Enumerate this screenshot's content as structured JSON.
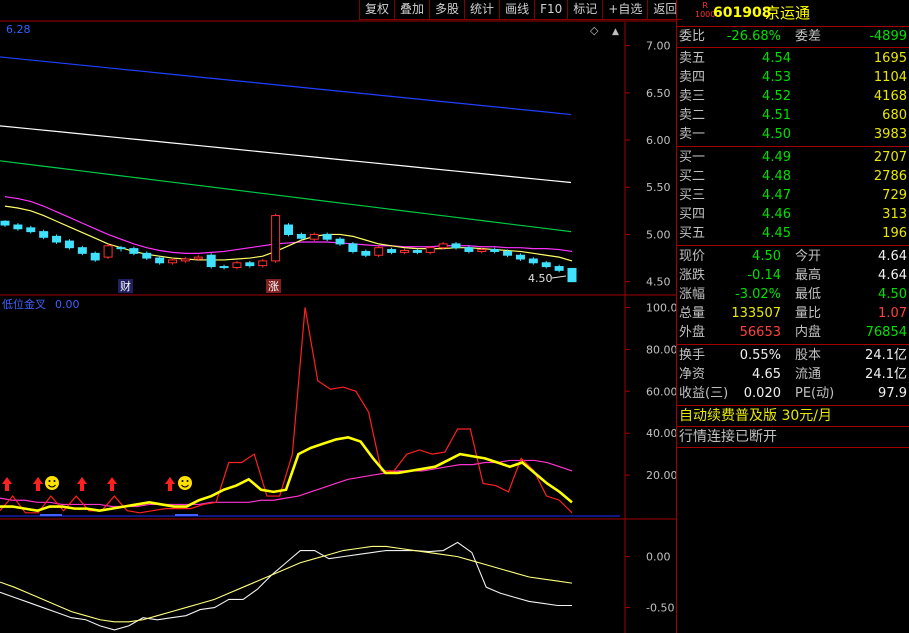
{
  "toolbar": [
    "复权",
    "叠加",
    "多股",
    "统计",
    "画线",
    "F10",
    "标记",
    "+自选",
    "返回"
  ],
  "main_panel": {
    "corner_value": "6.28",
    "price_ticks": [
      "7.00",
      "6.50",
      "6.00",
      "5.50",
      "5.00",
      "4.50"
    ],
    "last_price_label": "4.50",
    "markers": [
      {
        "text": "财",
        "color": "#ffffff",
        "bg": "#202060"
      },
      {
        "text": "涨",
        "color": "#ffffff",
        "bg": "#802020"
      }
    ]
  },
  "indicator_panel": {
    "title": "低位金叉",
    "value": "0.00",
    "ticks": [
      "100.0",
      "80.00",
      "60.00",
      "40.00",
      "20.00"
    ]
  },
  "osc_panel": {
    "ticks": [
      "0.00",
      "-0.50"
    ]
  },
  "quote": {
    "code": "601908",
    "name": "京运通",
    "r_badge": "R",
    "r_sub": "1000",
    "weibi_label": "委比",
    "weibi": "-26.68%",
    "weicha_label": "委差",
    "weicha": "-4899",
    "sell": [
      {
        "label": "卖五",
        "price": "4.54",
        "vol": "1695"
      },
      {
        "label": "卖四",
        "price": "4.53",
        "vol": "1104"
      },
      {
        "label": "卖三",
        "price": "4.52",
        "vol": "4168"
      },
      {
        "label": "卖二",
        "price": "4.51",
        "vol": "680"
      },
      {
        "label": "卖一",
        "price": "4.50",
        "vol": "3983"
      }
    ],
    "buy": [
      {
        "label": "买一",
        "price": "4.49",
        "vol": "2707"
      },
      {
        "label": "买二",
        "price": "4.48",
        "vol": "2786"
      },
      {
        "label": "买三",
        "price": "4.47",
        "vol": "729"
      },
      {
        "label": "买四",
        "price": "4.46",
        "vol": "313"
      },
      {
        "label": "买五",
        "price": "4.45",
        "vol": "196"
      }
    ],
    "stats": [
      {
        "l1": "现价",
        "v1": "4.50",
        "c1": "green",
        "l2": "今开",
        "v2": "4.64",
        "c2": "white"
      },
      {
        "l1": "涨跌",
        "v1": "-0.14",
        "c1": "green",
        "l2": "最高",
        "v2": "4.64",
        "c2": "white"
      },
      {
        "l1": "涨幅",
        "v1": "-3.02%",
        "c1": "green",
        "l2": "最低",
        "v2": "4.50",
        "c2": "green"
      },
      {
        "l1": "总量",
        "v1": "133507",
        "c1": "yellow",
        "l2": "量比",
        "v2": "1.07",
        "c2": "red"
      },
      {
        "l1": "外盘",
        "v1": "56653",
        "c1": "red",
        "l2": "内盘",
        "v2": "76854",
        "c2": "green"
      }
    ],
    "stats2": [
      {
        "l1": "换手",
        "v1": "0.55%",
        "c1": "white",
        "l2": "股本",
        "v2": "24.1亿",
        "c2": "white"
      },
      {
        "l1": "净资",
        "v1": "4.65",
        "c1": "white",
        "l2": "流通",
        "v2": "24.1亿",
        "c2": "white"
      },
      {
        "l1": "收益(三)",
        "v1": "0.020",
        "c1": "white",
        "l2": "PE(动)",
        "v2": "97.9",
        "c2": "white"
      }
    ],
    "promo": "自动续费普及版",
    "promo_price": "30元/月",
    "status": "行情连接已断开"
  },
  "chart_data": {
    "type": "candlestick",
    "panels": [
      {
        "name": "price",
        "ylim": [
          4.38,
          7.25
        ],
        "ticks": [
          7.0,
          6.5,
          6.0,
          5.5,
          5.0,
          4.5
        ],
        "last": 4.5
      },
      {
        "name": "indicator",
        "ylim": [
          0,
          105
        ],
        "ticks": [
          100,
          80,
          60,
          40,
          20
        ]
      },
      {
        "name": "oscillator",
        "ylim": [
          -0.75,
          0.35
        ],
        "ticks": [
          0.0,
          -0.5
        ]
      }
    ],
    "candles": [
      [
        5.14,
        5.1,
        5.15,
        5.08
      ],
      [
        5.1,
        5.06,
        5.12,
        5.04
      ],
      [
        5.07,
        5.03,
        5.09,
        5.01
      ],
      [
        5.03,
        4.97,
        5.05,
        4.95
      ],
      [
        4.98,
        4.92,
        5.0,
        4.9
      ],
      [
        4.93,
        4.86,
        4.95,
        4.84
      ],
      [
        4.86,
        4.8,
        4.88,
        4.78
      ],
      [
        4.8,
        4.73,
        4.82,
        4.71
      ],
      [
        4.76,
        4.88,
        4.9,
        4.74
      ],
      [
        4.86,
        4.85,
        4.88,
        4.82
      ],
      [
        4.85,
        4.8,
        4.87,
        4.78
      ],
      [
        4.8,
        4.75,
        4.82,
        4.73
      ],
      [
        4.75,
        4.7,
        4.77,
        4.68
      ],
      [
        4.7,
        4.73,
        4.75,
        4.68
      ],
      [
        4.72,
        4.74,
        4.76,
        4.7
      ],
      [
        4.74,
        4.76,
        4.78,
        4.72
      ],
      [
        4.78,
        4.66,
        4.8,
        4.64
      ],
      [
        4.66,
        4.65,
        4.68,
        4.63
      ],
      [
        4.65,
        4.7,
        4.72,
        4.63
      ],
      [
        4.7,
        4.67,
        4.72,
        4.65
      ],
      [
        4.67,
        4.72,
        4.74,
        4.65
      ],
      [
        4.72,
        5.2,
        5.22,
        4.7
      ],
      [
        5.1,
        5.0,
        5.12,
        4.98
      ],
      [
        5.0,
        4.96,
        5.02,
        4.94
      ],
      [
        4.95,
        5.0,
        5.02,
        4.93
      ],
      [
        5.0,
        4.95,
        5.02,
        4.93
      ],
      [
        4.95,
        4.9,
        4.97,
        4.88
      ],
      [
        4.9,
        4.82,
        4.92,
        4.8
      ],
      [
        4.82,
        4.78,
        4.84,
        4.76
      ],
      [
        4.78,
        4.86,
        4.88,
        4.76
      ],
      [
        4.84,
        4.81,
        4.86,
        4.79
      ],
      [
        4.81,
        4.83,
        4.85,
        4.79
      ],
      [
        4.83,
        4.81,
        4.85,
        4.79
      ],
      [
        4.81,
        4.86,
        4.88,
        4.79
      ],
      [
        4.86,
        4.9,
        4.92,
        4.84
      ],
      [
        4.9,
        4.86,
        4.92,
        4.84
      ],
      [
        4.86,
        4.82,
        4.88,
        4.8
      ],
      [
        4.82,
        4.84,
        4.86,
        4.8
      ],
      [
        4.84,
        4.82,
        4.86,
        4.8
      ],
      [
        4.82,
        4.78,
        4.84,
        4.76
      ],
      [
        4.78,
        4.74,
        4.8,
        4.72
      ],
      [
        4.74,
        4.7,
        4.76,
        4.68
      ],
      [
        4.7,
        4.66,
        4.72,
        4.64
      ],
      [
        4.66,
        4.62,
        4.68,
        4.6
      ],
      [
        4.64,
        4.5,
        4.64,
        4.5
      ]
    ],
    "ma": [
      {
        "color": "#2040ff",
        "from": 6.88,
        "to": 6.27
      },
      {
        "color": "#ffffff",
        "from": 6.15,
        "to": 5.55
      },
      {
        "color": "#00cc44",
        "from": 5.78,
        "to": 5.03
      },
      {
        "color": "#ff33ff",
        "p": [
          5.4,
          5.38,
          5.35,
          5.3,
          5.24,
          5.18,
          5.12,
          5.06,
          5.0,
          4.95,
          4.9,
          4.86,
          4.83,
          4.81,
          4.8,
          4.8,
          4.81,
          4.82,
          4.84,
          4.86,
          4.88,
          4.9,
          4.91,
          4.92,
          4.92,
          4.92,
          4.91,
          4.9,
          4.89,
          4.88,
          4.88,
          4.87,
          4.87,
          4.87,
          4.88,
          4.88,
          4.88,
          4.87,
          4.87,
          4.86,
          4.86,
          4.85,
          4.85,
          4.84,
          4.82
        ]
      },
      {
        "color": "#ffff66",
        "p": [
          5.3,
          5.28,
          5.25,
          5.2,
          5.14,
          5.08,
          5.02,
          4.96,
          4.9,
          4.86,
          4.82,
          4.79,
          4.77,
          4.75,
          4.74,
          4.73,
          4.73,
          4.73,
          4.74,
          4.75,
          4.77,
          4.82,
          4.88,
          4.94,
          4.98,
          5.0,
          5.0,
          4.98,
          4.94,
          4.9,
          4.88,
          4.86,
          4.85,
          4.85,
          4.85,
          4.86,
          4.86,
          4.85,
          4.84,
          4.83,
          4.82,
          4.8,
          4.78,
          4.76,
          4.72
        ]
      }
    ],
    "indicator_red": [
      3,
      10,
      2,
      2,
      10,
      3,
      10,
      3,
      3,
      10,
      3,
      2,
      3,
      4,
      4,
      4,
      6,
      7,
      26,
      26,
      30,
      10,
      10,
      30,
      100,
      65,
      61,
      62,
      60,
      50,
      22,
      22,
      30,
      32,
      30,
      31,
      42,
      42,
      16,
      15,
      12,
      28,
      22,
      10,
      8,
      2
    ],
    "indicator_yellow": [
      5,
      5,
      4,
      3,
      5,
      5,
      4,
      4,
      3,
      4,
      5,
      6,
      7,
      6,
      5,
      5,
      8,
      10,
      13,
      15,
      18,
      13,
      12,
      13,
      30,
      33,
      35,
      37,
      38,
      36,
      28,
      21,
      21,
      22,
      23,
      24,
      27,
      30,
      29,
      28,
      26,
      24,
      26,
      21,
      16,
      12,
      7
    ],
    "indicator_magenta": [
      9,
      8,
      8,
      7,
      7,
      6,
      6,
      6,
      6,
      5,
      5,
      5,
      6,
      6,
      6,
      6,
      6,
      7,
      7,
      7,
      7,
      8,
      8,
      9,
      10,
      12,
      14,
      16,
      18,
      19,
      20,
      21,
      22,
      22,
      22,
      23,
      24,
      25,
      25,
      26,
      26,
      27,
      27,
      27,
      26,
      24,
      22
    ],
    "osc_white": [
      -0.35,
      -0.4,
      -0.45,
      -0.5,
      -0.55,
      -0.6,
      -0.62,
      -0.68,
      -0.72,
      -0.68,
      -0.6,
      -0.62,
      -0.6,
      -0.58,
      -0.52,
      -0.5,
      -0.42,
      -0.42,
      -0.32,
      -0.18,
      -0.06,
      0.06,
      0.06,
      -0.02,
      0.0,
      0.02,
      0.04,
      0.06,
      0.06,
      0.06,
      0.05,
      0.06,
      0.14,
      0.04,
      -0.3,
      -0.36,
      -0.4,
      -0.44,
      -0.46,
      -0.48,
      -0.48
    ],
    "osc_yellow": [
      -0.25,
      -0.3,
      -0.36,
      -0.42,
      -0.48,
      -0.54,
      -0.58,
      -0.62,
      -0.64,
      -0.64,
      -0.62,
      -0.58,
      -0.54,
      -0.5,
      -0.46,
      -0.42,
      -0.36,
      -0.3,
      -0.24,
      -0.18,
      -0.12,
      -0.06,
      -0.02,
      0.02,
      0.06,
      0.08,
      0.1,
      0.1,
      0.08,
      0.06,
      0.04,
      0.02,
      0.0,
      -0.04,
      -0.08,
      -0.12,
      -0.16,
      -0.2,
      -0.22,
      -0.24,
      -0.26
    ]
  }
}
